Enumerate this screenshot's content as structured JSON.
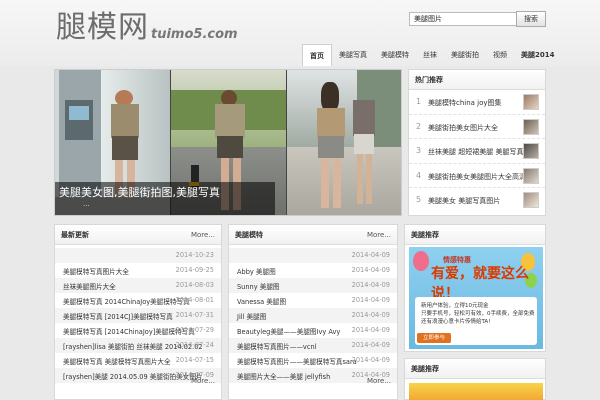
{
  "header": {
    "logo_main": "腿模网",
    "logo_sub": "tuimo5.com",
    "search_value": "美腿图片",
    "search_button": "搜索"
  },
  "nav": {
    "items": [
      "首页",
      "美腿写真",
      "美腿模特",
      "丝袜",
      "美腿街拍",
      "视频",
      "美腿2014"
    ]
  },
  "slider": {
    "title": "美腿美女图,美腿街拍图,美腿写真",
    "dots": "..."
  },
  "hot": {
    "title": "热门推荐",
    "items": [
      {
        "num": "1",
        "text": "美腿模特china joy图集"
      },
      {
        "num": "2",
        "text": "美腿街拍美女图片大全"
      },
      {
        "num": "3",
        "text": "丝袜美腿 超短裙美腿 美腿写真"
      },
      {
        "num": "4",
        "text": "美腿街拍美女美腿图片大全高清"
      },
      {
        "num": "5",
        "text": "美腿美女 美腿写真图片"
      }
    ]
  },
  "list_left": {
    "title": "最新更新",
    "more": "More...",
    "more_bottom": "More...",
    "rows": [
      {
        "t": "",
        "d": "2014-10-23"
      },
      {
        "t": "美腿模特写真图片大全",
        "d": "2014-09-25"
      },
      {
        "t": "丝袜美腿图片大全",
        "d": "2014-08-03"
      },
      {
        "t": "美腿模特写真 2014ChinaJoy美腿模特写真",
        "d": "2014-08-01"
      },
      {
        "t": "美腿模特写真 [2014CJ]美腿模特写真",
        "d": "2014-07-31"
      },
      {
        "t": "美腿模特写真 [2014ChinaJoy]美腿模特写真",
        "d": "2014-07-29"
      },
      {
        "t": "[rayshen]lisa 美腿街拍 丝袜美腿 2014.02.02",
        "d": "2014-07-24"
      },
      {
        "t": "美腿模特写真 美腿模特写真图片大全",
        "d": "2014-07-15"
      },
      {
        "t": "[rayshen]美腿 2014.05.09 美腿街拍美女图片",
        "d": "2014-07-09"
      }
    ]
  },
  "list_mid": {
    "title": "美腿模特",
    "more": "More...",
    "more_bottom": "More...",
    "rows": [
      {
        "t": "",
        "d": "2014-04-09"
      },
      {
        "t": "Abby 美腿图",
        "d": "2014-04-09"
      },
      {
        "t": "Sunny 美腿图",
        "d": "2014-04-09"
      },
      {
        "t": "Vanessa 美腿图",
        "d": "2014-04-09"
      },
      {
        "t": "Jill 美腿图",
        "d": "2014-04-09"
      },
      {
        "t": "Beautyleg美腿——美腿图Ivy Avy",
        "d": "2014-04-09"
      },
      {
        "t": "美腿模特写真图片——vcnl",
        "d": "2014-04-09"
      },
      {
        "t": "美腿模特写真图片——美腿模特写真sara",
        "d": "2014-04-09"
      },
      {
        "t": "美腿图片大全——美腿 jellyfish",
        "d": "2014-04-09"
      }
    ]
  },
  "reco": {
    "title": "美腿推荐",
    "ad_head": "情感特惠",
    "ad_big": "有爱，就要这么说！",
    "ad_lines": [
      "新用户体验，立得10元现金",
      "只要手机号，轻松可有效，0手续费，全部免费",
      "还有浪漫心意卡片传情给TA!"
    ],
    "ad_cta": "立即参与"
  },
  "reco2": {
    "title": "美腿推荐"
  }
}
